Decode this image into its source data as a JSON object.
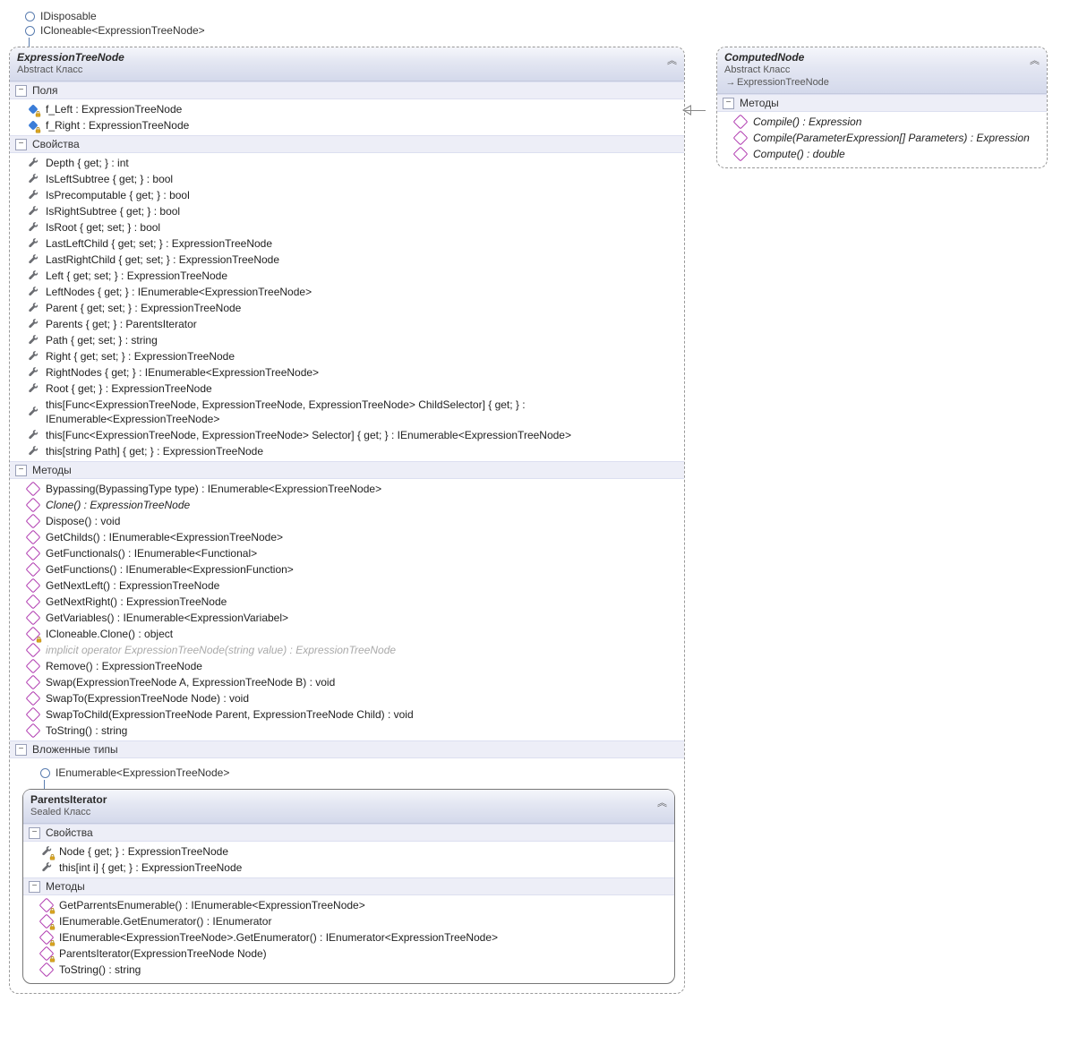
{
  "interfaces_top": [
    "IDisposable",
    "ICloneable<ExpressionTreeNode>"
  ],
  "main": {
    "title": "ExpressionTreeNode",
    "subtitle": "Abstract Класс",
    "sections": {
      "fields": {
        "label": "Поля",
        "items": [
          {
            "text": "f_Left : ExpressionTreeNode",
            "locked": true
          },
          {
            "text": "f_Right : ExpressionTreeNode",
            "locked": true
          }
        ]
      },
      "props": {
        "label": "Свойства",
        "items": [
          {
            "text": "Depth { get; } : int"
          },
          {
            "text": "IsLeftSubtree { get; } : bool"
          },
          {
            "text": "IsPrecomputable { get; } : bool"
          },
          {
            "text": "IsRightSubtree { get; } : bool"
          },
          {
            "text": "IsRoot { get; set; } : bool"
          },
          {
            "text": "LastLeftChild { get; set; } : ExpressionTreeNode"
          },
          {
            "text": "LastRightChild { get; set; } : ExpressionTreeNode"
          },
          {
            "text": "Left { get; set; } : ExpressionTreeNode"
          },
          {
            "text": "LeftNodes { get; } : IEnumerable<ExpressionTreeNode>"
          },
          {
            "text": "Parent { get; set; } : ExpressionTreeNode"
          },
          {
            "text": "Parents { get; } : ParentsIterator"
          },
          {
            "text": "Path { get; set; } : string"
          },
          {
            "text": "Right { get; set; } : ExpressionTreeNode"
          },
          {
            "text": "RightNodes { get; } : IEnumerable<ExpressionTreeNode>"
          },
          {
            "text": "Root { get; } : ExpressionTreeNode"
          },
          {
            "text": "this[Func<ExpressionTreeNode, ExpressionTreeNode, ExpressionTreeNode> ChildSelector] { get; } : IEnumerable<ExpressionTreeNode>"
          },
          {
            "text": "this[Func<ExpressionTreeNode, ExpressionTreeNode> Selector] { get; } : IEnumerable<ExpressionTreeNode>"
          },
          {
            "text": "this[string Path] { get; } : ExpressionTreeNode"
          }
        ]
      },
      "methods": {
        "label": "Методы",
        "items": [
          {
            "text": "Bypassing(BypassingType type) : IEnumerable<ExpressionTreeNode>"
          },
          {
            "text": "Clone() : ExpressionTreeNode",
            "italic": true
          },
          {
            "text": "Dispose() : void"
          },
          {
            "text": "GetChilds() : IEnumerable<ExpressionTreeNode>"
          },
          {
            "text": "GetFunctionals() : IEnumerable<Functional>"
          },
          {
            "text": "GetFunctions() : IEnumerable<ExpressionFunction>"
          },
          {
            "text": "GetNextLeft() : ExpressionTreeNode"
          },
          {
            "text": "GetNextRight() : ExpressionTreeNode"
          },
          {
            "text": "GetVariables() : IEnumerable<ExpressionVariabel>"
          },
          {
            "text": "ICloneable.Clone() : object",
            "locked": true
          },
          {
            "text": "implicit operator ExpressionTreeNode(string value) : ExpressionTreeNode",
            "gray": true
          },
          {
            "text": "Remove() : ExpressionTreeNode"
          },
          {
            "text": "Swap(ExpressionTreeNode A, ExpressionTreeNode B) : void"
          },
          {
            "text": "SwapTo(ExpressionTreeNode Node) : void"
          },
          {
            "text": "SwapToChild(ExpressionTreeNode Parent, ExpressionTreeNode Child) : void"
          },
          {
            "text": "ToString() : string"
          }
        ]
      },
      "nested": {
        "label": "Вложенные типы"
      }
    }
  },
  "nested": {
    "interfaces": [
      "IEnumerable<ExpressionTreeNode>"
    ],
    "title": "ParentsIterator",
    "subtitle": "Sealed Класс",
    "sections": {
      "props": {
        "label": "Свойства",
        "items": [
          {
            "text": "Node { get; } : ExpressionTreeNode",
            "locked": true
          },
          {
            "text": "this[int i] { get; } : ExpressionTreeNode"
          }
        ]
      },
      "methods": {
        "label": "Методы",
        "items": [
          {
            "text": "GetParrentsEnumerable() : IEnumerable<ExpressionTreeNode>",
            "locked": true
          },
          {
            "text": "IEnumerable.GetEnumerator() : IEnumerator",
            "locked": true
          },
          {
            "text": "IEnumerable<ExpressionTreeNode>.GetEnumerator()  :  IEnumerator<ExpressionTreeNode>",
            "locked": true
          },
          {
            "text": "ParentsIterator(ExpressionTreeNode Node)",
            "locked": true
          },
          {
            "text": "ToString() : string"
          }
        ]
      }
    }
  },
  "right": {
    "title": "ComputedNode",
    "subtitle1": "Abstract Класс",
    "subtitle2": "ExpressionTreeNode",
    "sections": {
      "methods": {
        "label": "Методы",
        "items": [
          {
            "text": "Compile() : Expression",
            "italic": true
          },
          {
            "text": "Compile(ParameterExpression[] Parameters) : Expression",
            "italic": true
          },
          {
            "text": "Compute() : double",
            "italic": true
          }
        ]
      }
    }
  }
}
